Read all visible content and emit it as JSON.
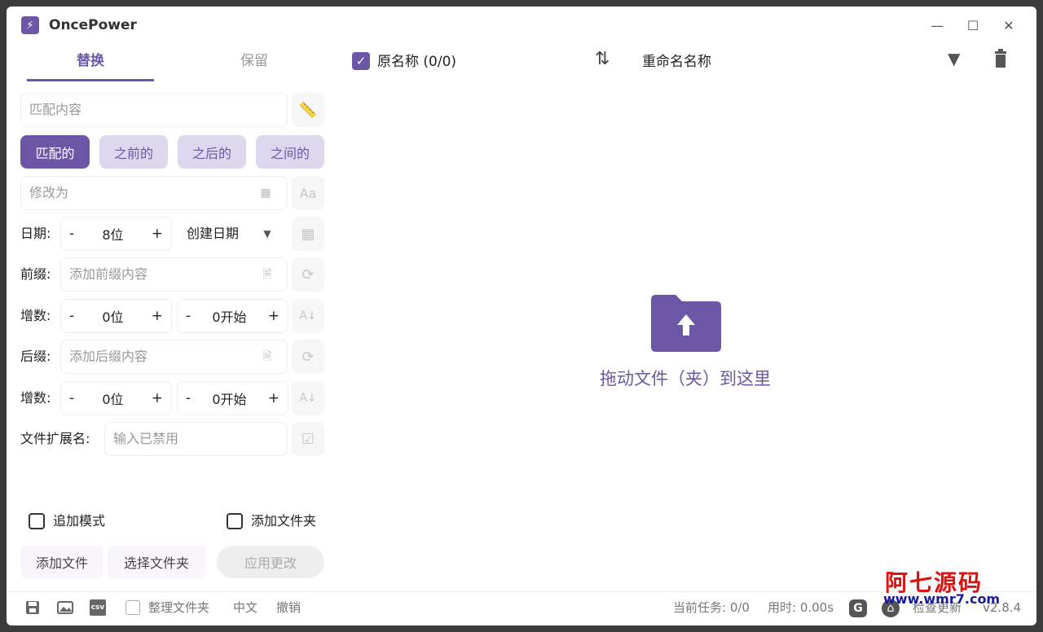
{
  "app": {
    "title": "OncePower"
  },
  "tabs": {
    "replace": "替换",
    "keep": "保留"
  },
  "match": {
    "placeholder": "匹配内容"
  },
  "modes": [
    "匹配的",
    "之前的",
    "之后的",
    "之间的"
  ],
  "modify": {
    "placeholder": "修改为"
  },
  "date": {
    "label": "日期:",
    "minus": "-",
    "value": "8位",
    "plus": "+",
    "type": "创建日期"
  },
  "prefix": {
    "label": "前缀:",
    "placeholder": "添加前缀内容"
  },
  "prefix_inc": {
    "label": "增数:",
    "digits": "0位",
    "start": "0开始",
    "minus": "-",
    "plus": "+"
  },
  "suffix": {
    "label": "后缀:",
    "placeholder": "添加后缀内容"
  },
  "suffix_inc": {
    "label": "增数:",
    "digits": "0位",
    "start": "0开始",
    "minus": "-",
    "plus": "+"
  },
  "ext": {
    "label": "文件扩展名:",
    "placeholder": "输入已禁用"
  },
  "options": {
    "append_mode": "追加模式",
    "add_folder": "添加文件夹"
  },
  "buttons": {
    "add_file": "添加文件",
    "select_folder": "选择文件夹",
    "apply": "应用更改"
  },
  "list_header": {
    "original": "原名称 (0/0)",
    "renamed": "重命名名称"
  },
  "drop": {
    "text": "拖动文件（夹）到这里"
  },
  "status": {
    "organize": "整理文件夹",
    "lang": "中文",
    "undo": "撤销",
    "tasks": "当前任务: 0/0",
    "time": "用时: 0.00s",
    "check_update": "检查更新",
    "version": "v2.8.4"
  },
  "watermark": {
    "line1": "阿七源码",
    "line2": "www.wmr7.com"
  },
  "colors": {
    "accent": "#6b57a5",
    "accent_light": "#ddd8ee"
  }
}
